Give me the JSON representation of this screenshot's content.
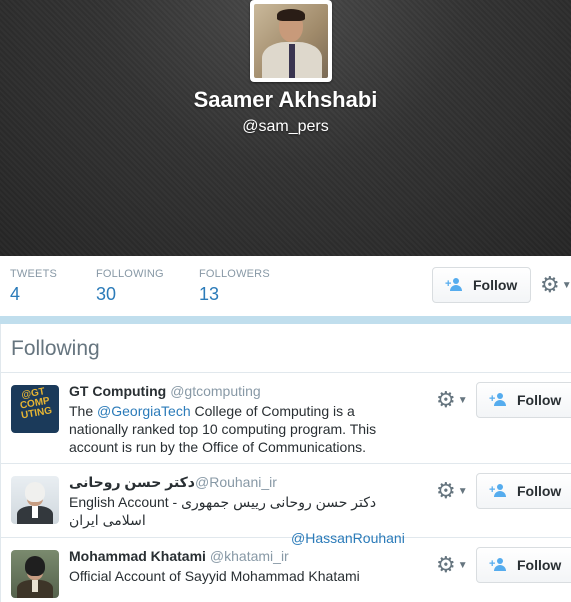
{
  "profile": {
    "name": "Saamer Akhshabi",
    "handle": "@sam_pers"
  },
  "stats": [
    {
      "label": "TWEETS",
      "value": "4"
    },
    {
      "label": "FOLLOWING",
      "value": "30"
    },
    {
      "label": "FOLLOWERS",
      "value": "13"
    }
  ],
  "actions": {
    "follow_label": "Follow",
    "gear_icon": "gear-icon",
    "caret_icon": "chevron-down-icon"
  },
  "panel": {
    "title": "Following"
  },
  "following": [
    {
      "name": "GT Computing",
      "handle": "@gtcomputing",
      "avatar_text": "@GT COMP UTING",
      "bio_before": "The ",
      "bio_link": "@GeorgiaTech",
      "bio_after": " College of Computing is a nationally ranked top 10 computing program. This account is run by the Office of Communications.",
      "follow_label": "Follow"
    },
    {
      "name": "دکتر حسن روحانی",
      "handle": "@Rouhani_ir",
      "bio_before": "English Account - دکتر حسن روحانی رییس جمهوری اسلامی ایران",
      "bio_link": "@HassanRouhani",
      "follow_label": "Follow"
    },
    {
      "name": "Mohammad Khatami",
      "handle": "@khatami_ir",
      "bio_before": "Official Account of Sayyid Mohammad Khatami",
      "follow_label": "Follow"
    }
  ],
  "colors": {
    "accent": "#2b7bb9",
    "divider": "#c0deed",
    "follow_icon": "#55acee"
  }
}
